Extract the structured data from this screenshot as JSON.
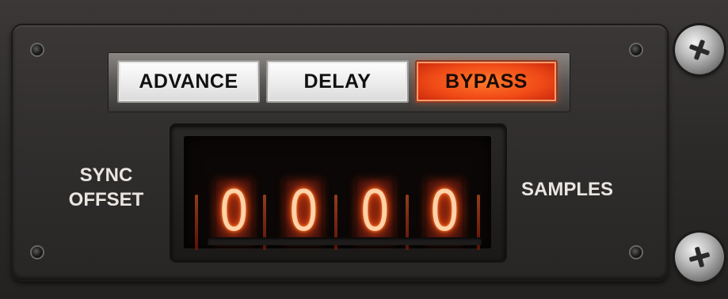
{
  "buttons": [
    {
      "label": "ADVANCE",
      "active": false
    },
    {
      "label": "DELAY",
      "active": false
    },
    {
      "label": "BYPASS",
      "active": true
    }
  ],
  "labels": {
    "left_line1": "SYNC",
    "left_line2": "OFFSET",
    "right": "SAMPLES"
  },
  "display": {
    "digits": [
      "0",
      "0",
      "0",
      "0"
    ]
  },
  "colors": {
    "active_button": "#f04a17",
    "nixie_glow": "#ff5a14",
    "panel": "#2f2d2c"
  },
  "icons": {
    "screw": "phillips-screw-icon",
    "mount_hole": "mount-hole-icon"
  }
}
